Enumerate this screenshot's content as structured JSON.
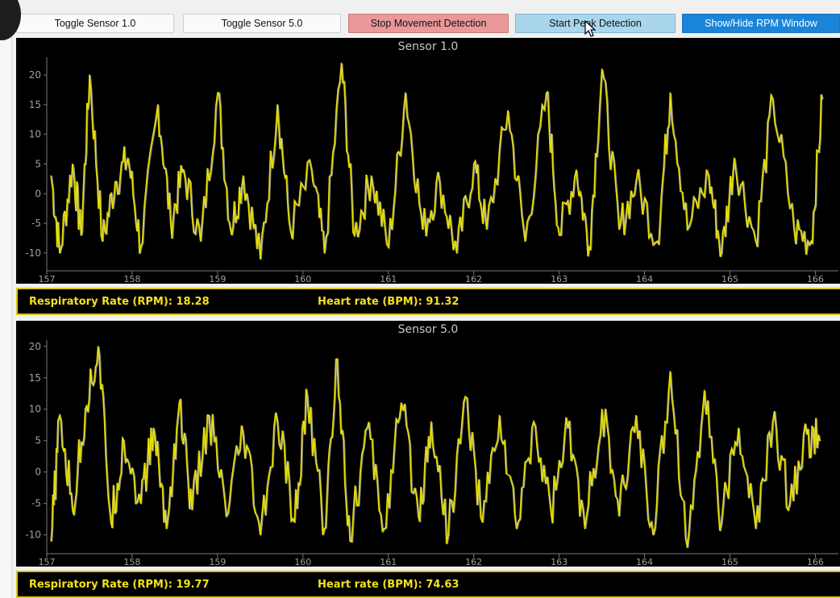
{
  "toolbar": {
    "toggle_sensor_1_label": "Toggle Sensor 1.0",
    "toggle_sensor_5_label": "Toggle Sensor 5.0",
    "stop_movement_label": "Stop Movement Detection",
    "start_peak_label": "Start Peak Detection",
    "show_hide_rpm_label": "Show/Hide RPM Window"
  },
  "colors": {
    "signal_primary": "#e8e000",
    "signal_secondary": "#b4b4b4",
    "axis": "#7a7a7a",
    "stat_text": "#f2e21c"
  },
  "sensor1": {
    "title": "Sensor 1.0",
    "rpm_label": "Respiratory Rate (RPM): 18.28",
    "bpm_label": "Heart rate (BPM): 91.32"
  },
  "sensor5": {
    "title": "Sensor 5.0",
    "rpm_label": "Respiratory Rate (RPM): 19.77",
    "bpm_label": "Heart rate (BPM): 74.63"
  },
  "chart_data": [
    {
      "type": "line",
      "title": "Sensor 1.0",
      "xlabel": "",
      "ylabel": "",
      "xlim": [
        157,
        166.1
      ],
      "ylim": [
        -13,
        23
      ],
      "xticks": [
        157,
        158,
        159,
        160,
        161,
        162,
        163,
        164,
        165,
        166
      ],
      "yticks": [
        -10,
        -5,
        0,
        5,
        10,
        15,
        20
      ],
      "grid": false,
      "series": [
        {
          "color": "yellow",
          "x": [
            157.05,
            157.15,
            157.3,
            157.4,
            157.5,
            157.65,
            157.8,
            157.95,
            158.1,
            158.3,
            158.45,
            158.6,
            158.8,
            159.0,
            159.15,
            159.3,
            159.5,
            159.7,
            159.85,
            160.1,
            160.25,
            160.45,
            160.6,
            160.8,
            161.0,
            161.2,
            161.4,
            161.6,
            161.8,
            162.0,
            162.15,
            162.4,
            162.6,
            162.85,
            163.0,
            163.2,
            163.35,
            163.5,
            163.7,
            163.9,
            164.15,
            164.3,
            164.5,
            164.75,
            164.9,
            165.05,
            165.3,
            165.5,
            165.75,
            165.95,
            166.08
          ],
          "values": [
            3,
            -10,
            5,
            -7,
            20,
            -8,
            2,
            6,
            -9,
            15,
            -5,
            4,
            -8,
            17,
            -6,
            3,
            -11,
            15,
            -6,
            4,
            -10,
            22,
            -7,
            3,
            -9,
            17,
            -6,
            2,
            -10,
            5,
            -6,
            14,
            -8,
            17,
            -7,
            4,
            -9,
            21,
            -6,
            2,
            -8,
            17,
            -6,
            3,
            -10,
            6,
            -8,
            16,
            -6,
            -8,
            16
          ]
        }
      ]
    },
    {
      "type": "line",
      "title": "Sensor 5.0",
      "xlabel": "",
      "ylabel": "",
      "xlim": [
        157,
        166.1
      ],
      "ylim": [
        -13,
        21
      ],
      "xticks": [
        157,
        158,
        159,
        160,
        161,
        162,
        163,
        164,
        165,
        166
      ],
      "yticks": [
        -10,
        -5,
        0,
        5,
        10,
        15,
        20
      ],
      "grid": false,
      "series": [
        {
          "color": "yellow",
          "x": [
            157.05,
            157.15,
            157.3,
            157.45,
            157.6,
            157.75,
            157.9,
            158.1,
            158.25,
            158.4,
            158.55,
            158.7,
            158.9,
            159.1,
            159.3,
            159.5,
            159.7,
            159.9,
            160.05,
            160.25,
            160.4,
            160.55,
            160.75,
            160.95,
            161.15,
            161.35,
            161.5,
            161.7,
            161.9,
            162.1,
            162.3,
            162.5,
            162.7,
            162.9,
            163.1,
            163.3,
            163.5,
            163.7,
            163.9,
            164.1,
            164.3,
            164.5,
            164.7,
            164.9,
            165.1,
            165.3,
            165.5,
            165.7,
            165.9,
            166.05
          ],
          "values": [
            -11,
            9,
            -6,
            10,
            20,
            -8,
            5,
            -5,
            7,
            -9,
            11,
            -6,
            9,
            -7,
            6,
            -10,
            8,
            -8,
            12,
            -9,
            18,
            -11,
            7,
            -9,
            11,
            -7,
            8,
            -10,
            12,
            -8,
            9,
            -9,
            8,
            -6,
            7,
            -9,
            10,
            -7,
            9,
            -10,
            16,
            -12,
            13,
            -8,
            7,
            -9,
            8,
            -5,
            6,
            5
          ]
        }
      ]
    }
  ]
}
